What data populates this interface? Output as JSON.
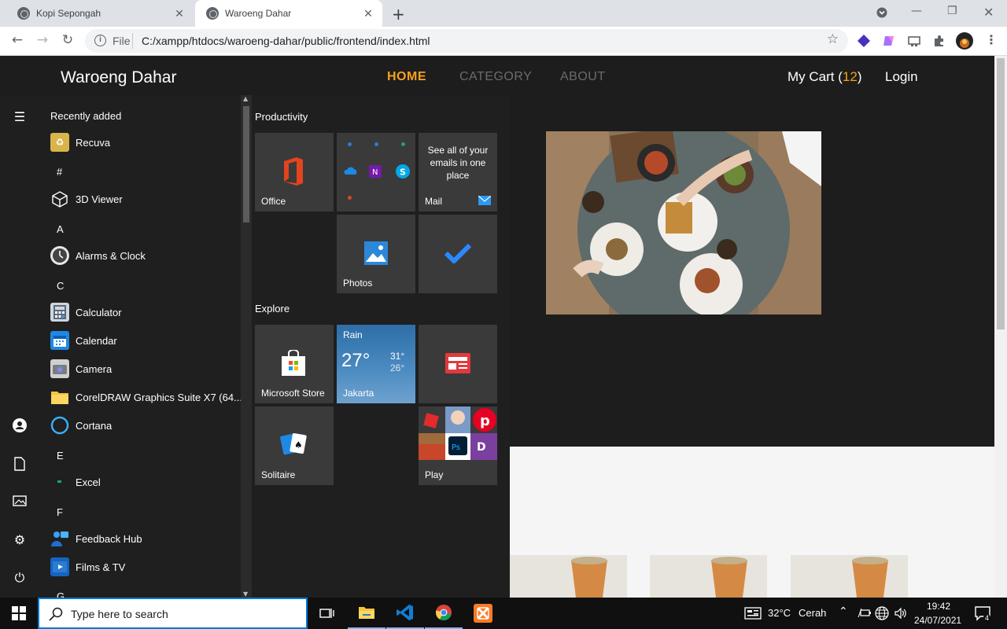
{
  "browser": {
    "tabs": [
      {
        "label": "Kopi Sepongah",
        "active": false
      },
      {
        "label": "Waroeng Dahar",
        "active": true
      }
    ],
    "new_tab_icon": "plus-icon",
    "address": {
      "scheme": "File",
      "url": "C:/xampp/htdocs/waroeng-dahar/public/frontend/index.html"
    }
  },
  "site": {
    "brand": "Waroeng Dahar",
    "nav": [
      {
        "label": "HOME",
        "active": true
      },
      {
        "label": "CATEGORY",
        "active": false
      },
      {
        "label": "ABOUT",
        "active": false
      }
    ],
    "cart_label": "My Cart (",
    "cart_count": "12",
    "cart_close": ")",
    "login": "Login",
    "colors": {
      "accent": "#f7a11a",
      "nav_inactive": "#6b6b6b",
      "background": "#1d1d1d"
    }
  },
  "start_menu": {
    "recently_added_label": "Recently added",
    "recent": [
      {
        "label": "Recuva",
        "icon": "recuva-icon"
      }
    ],
    "groups": [
      {
        "letter": "#",
        "apps": [
          {
            "label": "3D Viewer",
            "icon": "cube-icon"
          }
        ]
      },
      {
        "letter": "A",
        "apps": [
          {
            "label": "Alarms & Clock",
            "icon": "clock-icon"
          }
        ]
      },
      {
        "letter": "C",
        "apps": [
          {
            "label": "Calculator",
            "icon": "calculator-icon"
          },
          {
            "label": "Calendar",
            "icon": "calendar-icon"
          },
          {
            "label": "Camera",
            "icon": "camera-icon"
          },
          {
            "label": "CorelDRAW Graphics Suite X7 (64...",
            "icon": "folder-icon"
          },
          {
            "label": "Cortana",
            "icon": "cortana-icon"
          }
        ]
      },
      {
        "letter": "E",
        "apps": [
          {
            "label": "Excel",
            "icon": "excel-icon"
          }
        ]
      },
      {
        "letter": "F",
        "apps": [
          {
            "label": "Feedback Hub",
            "icon": "feedback-icon"
          },
          {
            "label": "Films & TV",
            "icon": "film-icon"
          }
        ]
      },
      {
        "letter": "G",
        "apps": []
      }
    ],
    "productivity_label": "Productivity",
    "explore_label": "Explore",
    "tiles": {
      "office": "Office",
      "mail_text": "See all of your emails in one place",
      "mail": "Mail",
      "photos": "Photos",
      "store": "Microsoft Store",
      "weather_cond": "Rain",
      "weather_temp": "27°",
      "weather_high": "31°",
      "weather_low": "26°",
      "weather_city": "Jakarta",
      "solitaire": "Solitaire",
      "play": "Play"
    }
  },
  "taskbar": {
    "search_placeholder": "Type here to search",
    "weather_temp": "32°C",
    "weather_cond": "Cerah",
    "time": "19:42",
    "date": "24/07/2021",
    "notification_count": "4"
  }
}
